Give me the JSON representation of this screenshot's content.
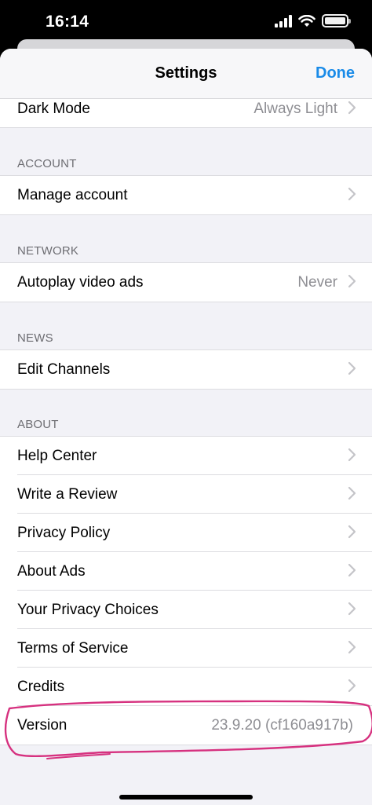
{
  "status_bar": {
    "time": "16:14"
  },
  "nav": {
    "title": "Settings",
    "done_label": "Done"
  },
  "appearance": {
    "dark_mode_label": "Dark Mode",
    "dark_mode_value": "Always Light"
  },
  "account": {
    "header": "ACCOUNT",
    "manage_label": "Manage account"
  },
  "network": {
    "header": "NETWORK",
    "autoplay_label": "Autoplay video ads",
    "autoplay_value": "Never"
  },
  "news": {
    "header": "NEWS",
    "edit_channels_label": "Edit Channels"
  },
  "about": {
    "header": "ABOUT",
    "items": [
      {
        "label": "Help Center"
      },
      {
        "label": "Write a Review"
      },
      {
        "label": "Privacy Policy"
      },
      {
        "label": "About Ads"
      },
      {
        "label": "Your Privacy Choices"
      },
      {
        "label": "Terms of Service"
      },
      {
        "label": "Credits"
      }
    ],
    "version_label": "Version",
    "version_value": "23.9.20 (cf160a917b)"
  },
  "colors": {
    "accent": "#1a8be8",
    "annotation": "#d6317f",
    "background": "#f2f2f7"
  }
}
